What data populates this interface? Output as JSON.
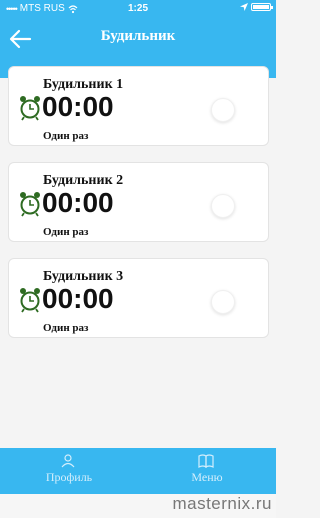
{
  "status_bar": {
    "signal_dots": "•••••",
    "carrier": "MTS RUS",
    "time": "1:25",
    "wifi_icon": "wifi-icon",
    "location_icon": "location-arrow-icon",
    "battery_icon": "battery-icon"
  },
  "header": {
    "title": "Будильник",
    "back_icon": "arrow-left-icon",
    "background": "#38b7f0"
  },
  "alarms": [
    {
      "title": "Будильник 1",
      "time": "00:00",
      "repeat": "Один раз",
      "icon": "alarm-clock-icon",
      "enabled": false
    },
    {
      "title": "Будильник 2",
      "time": "00:00",
      "repeat": "Один раз",
      "icon": "alarm-clock-icon",
      "enabled": false
    },
    {
      "title": "Будильник 3",
      "time": "00:00",
      "repeat": "Один раз",
      "icon": "alarm-clock-icon",
      "enabled": false
    }
  ],
  "tabbar": {
    "tabs": [
      {
        "label": "Профиль",
        "icon": "user-icon"
      },
      {
        "label": "Меню",
        "icon": "book-icon"
      }
    ]
  },
  "watermark": "masternix.ru",
  "colors": {
    "accent": "#38b7f0",
    "icon_green": "#2e6b22"
  }
}
